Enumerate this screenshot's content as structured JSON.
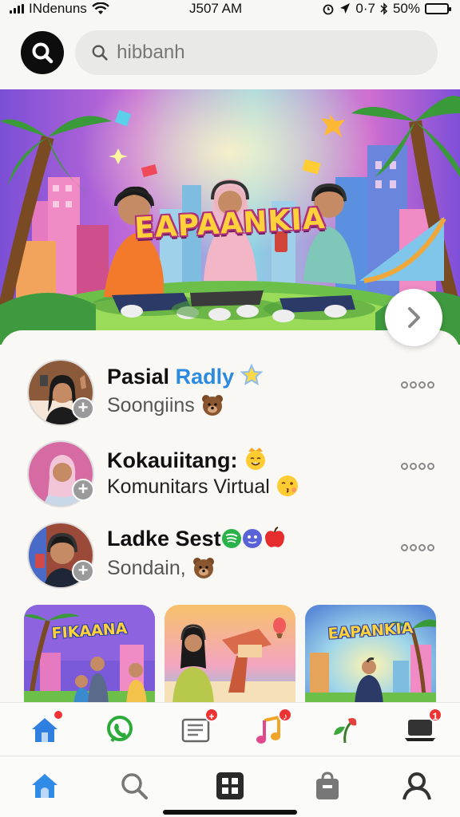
{
  "status_bar": {
    "carrier": "INdenuns",
    "time": "J507 AM",
    "extra": "0·7",
    "battery": "50%",
    "battery_level": 0.5
  },
  "search": {
    "placeholder": "hibbanh"
  },
  "hero": {
    "title": "EAPAANKIA"
  },
  "list": [
    {
      "name_main": "Pasial",
      "name_accent": "Radly",
      "name_emoji": "star-emoji",
      "sub": "Soongiins",
      "sub_emoji": "bear-emoji"
    },
    {
      "name_main": "Kokauiitang:",
      "name_accent": "",
      "name_emoji": "crown-face-emoji",
      "sub": "Komunitars Virtual",
      "sub_emoji": "kiss-face-emoji"
    },
    {
      "name_main": "Ladke Sest",
      "name_accent": "",
      "name_emoji": "spotify-emoji",
      "sub": "Sondain,",
      "sub_emoji": "bear-emoji"
    }
  ],
  "thumbnails": [
    {
      "title": "FIKAANA"
    },
    {
      "title": ""
    },
    {
      "title": "EAPANKIA"
    }
  ],
  "action_bar": {
    "items": [
      {
        "icon": "home-icon",
        "badge": ""
      },
      {
        "icon": "phone-chat-icon",
        "badge": ""
      },
      {
        "icon": "news-icon",
        "badge": "+"
      },
      {
        "icon": "music-icon",
        "badge": "♪"
      },
      {
        "icon": "leaf-icon",
        "badge": ""
      },
      {
        "icon": "laptop-icon",
        "badge": "1"
      }
    ]
  },
  "bottom_nav": {
    "items": [
      "home-icon",
      "search-icon",
      "grid-icon",
      "bag-icon",
      "profile-icon"
    ]
  },
  "colors": {
    "accent": "#2c8be0",
    "badge": "#e33333",
    "search_bg": "#e9e9e7"
  }
}
